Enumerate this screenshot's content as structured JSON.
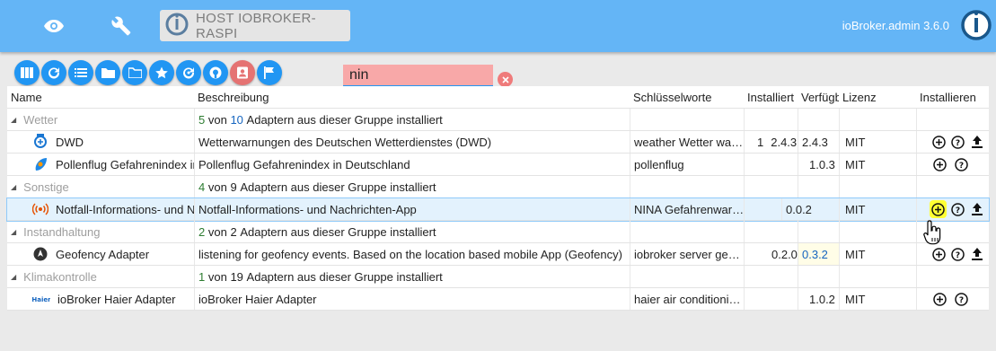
{
  "header": {
    "host_label": "HOST IOBROKER-RASPI",
    "version": "ioBroker.admin 3.6.0",
    "icons": [
      "eye-icon",
      "wrench-icon",
      "iobroker-logo"
    ]
  },
  "toolbar": {
    "buttons": [
      "columns-icon",
      "refresh-icon",
      "list-icon",
      "folder-icon",
      "folder-open-icon",
      "star-icon",
      "update-icon",
      "github-icon",
      "contact-icon",
      "flag-icon"
    ],
    "search_value": "nin"
  },
  "columns": {
    "name": "Name",
    "desc": "Beschreibung",
    "keys": "Schlüsselworte",
    "installed": "Installiert",
    "available": "Verfügbar",
    "license": "Lizenz",
    "install": "Installieren"
  },
  "groups": {
    "wetter": {
      "label": "Wetter",
      "installed": "5",
      "mid": "von",
      "total": "10",
      "suffix": "Adaptern aus dieser Gruppe installiert"
    },
    "sonstige": {
      "label": "Sonstige",
      "installed": "4",
      "mid": "von",
      "total": "9",
      "suffix": "Adaptern aus dieser Gruppe installiert"
    },
    "instand": {
      "label": "Instandhaltung",
      "installed": "2",
      "mid": "von",
      "total": "2",
      "suffix": "Adaptern aus dieser Gruppe installiert"
    },
    "klima": {
      "label": "Klimakontrolle",
      "installed": "1",
      "mid": "von",
      "total": "19",
      "suffix": "Adaptern aus dieser Gruppe installiert"
    }
  },
  "adapters": {
    "dwd": {
      "name": "DWD",
      "desc": "Wetterwarnungen des Deutschen Wetterdienstes (DWD)",
      "keys": "weather Wetter wa…",
      "inst_count": "1",
      "installed": "2.4.3",
      "available": "2.4.3",
      "license": "MIT"
    },
    "pollen": {
      "name": "Pollenflug Gefahrenindex in Deutschland",
      "desc": "Pollenflug Gefahrenindex in Deutschland",
      "keys": "pollenflug",
      "available": "1.0.3",
      "license": "MIT"
    },
    "nina": {
      "name": "Notfall-Informations- und Nachrichten-App",
      "desc": "Notfall-Informations- und Nachrichten-App",
      "keys": "NINA Gefahrenwar…",
      "available": "0.0.2",
      "license": "MIT"
    },
    "geofency": {
      "name": "Geofency Adapter",
      "desc": "listening for geofency events. Based on the location based mobile App (Geofency)",
      "keys": "iobroker server ge…",
      "installed": "0.2.0",
      "available": "0.3.2",
      "license": "MIT"
    },
    "haier": {
      "name": "ioBroker Haier Adapter",
      "desc": "ioBroker Haier Adapter",
      "keys": "haier air conditioni…",
      "available": "1.0.2",
      "license": "MIT",
      "logo_text": "Haier"
    }
  }
}
